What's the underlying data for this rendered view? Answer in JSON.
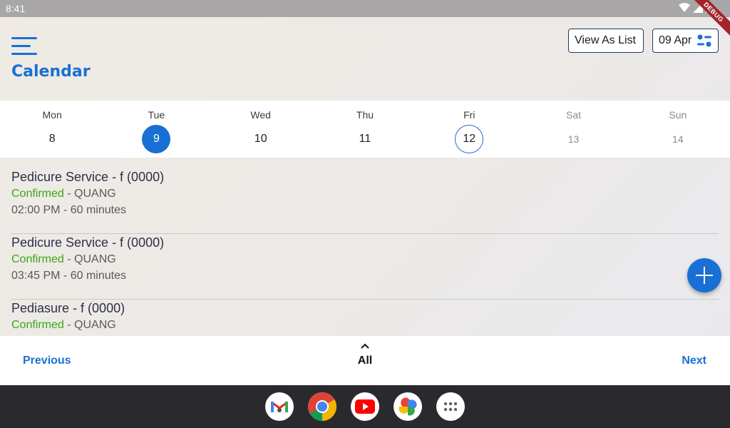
{
  "status_bar": {
    "time": "8:41",
    "debug_label": "DEBUG"
  },
  "header": {
    "title": "Calendar",
    "view_as_list_label": "View As List",
    "date_label": "09 Apr"
  },
  "week": [
    {
      "name": "Mon",
      "num": "8"
    },
    {
      "name": "Tue",
      "num": "9"
    },
    {
      "name": "Wed",
      "num": "10"
    },
    {
      "name": "Thu",
      "num": "11"
    },
    {
      "name": "Fri",
      "num": "12"
    },
    {
      "name": "Sat",
      "num": "13"
    },
    {
      "name": "Sun",
      "num": "14"
    }
  ],
  "appointments": [
    {
      "title": "Pedicure Service - f (0000)",
      "status": "Confirmed",
      "staff": " - QUANG",
      "time": "02:00 PM - 60 minutes"
    },
    {
      "title": "Pedicure Service - f (0000)",
      "status": "Confirmed",
      "staff": " - QUANG",
      "time": "03:45 PM - 60 minutes"
    },
    {
      "title": "Pediasure - f (0000)",
      "status": "Confirmed",
      "staff": " - QUANG",
      "time": ""
    }
  ],
  "bottom_nav": {
    "previous": "Previous",
    "all": "All",
    "next": "Next"
  },
  "colors": {
    "accent": "#1a6fd4",
    "confirmed": "#3aa616"
  },
  "dock": [
    "gmail-icon",
    "chrome-icon",
    "youtube-icon",
    "photos-icon",
    "app-drawer-icon"
  ]
}
